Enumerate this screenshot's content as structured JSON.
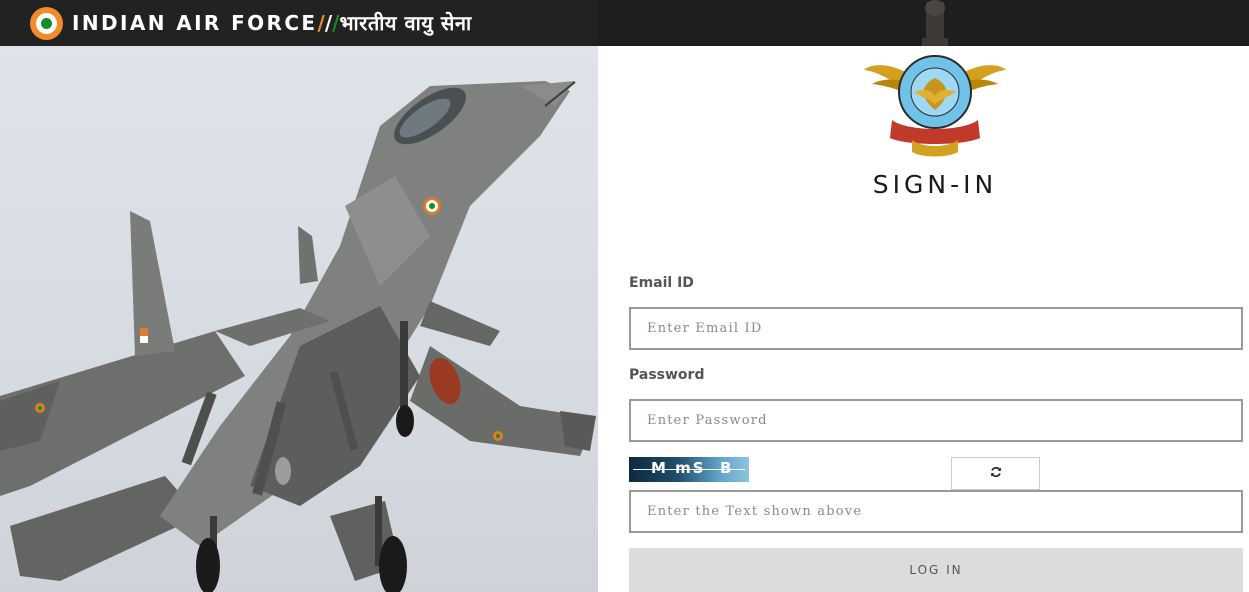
{
  "header": {
    "title_en": "INDIAN AIR FORCE",
    "slash1": "/",
    "slash2": "/",
    "slash3": "/",
    "title_hi": "भारतीय वायु सेना",
    "logo_icon": "iaf-roundel-icon"
  },
  "form": {
    "heading": "SIGN-IN",
    "email_label": "Email ID",
    "email_placeholder": "Enter Email ID",
    "email_value": "",
    "password_label": "Password",
    "password_placeholder": "Enter Password",
    "password_value": "",
    "captcha_text": "M mS  B  u",
    "captcha_placeholder": "Enter the Text shown above",
    "captcha_value": "",
    "refresh_icon": "refresh-icon",
    "login_label": "LOG IN"
  },
  "emblem": {
    "icon": "iaf-crest-icon"
  },
  "colors": {
    "saffron": "#f28c28",
    "green": "#1b8a2a",
    "header_bg": "#1e1e1e",
    "button_bg": "#dcdcdc"
  }
}
